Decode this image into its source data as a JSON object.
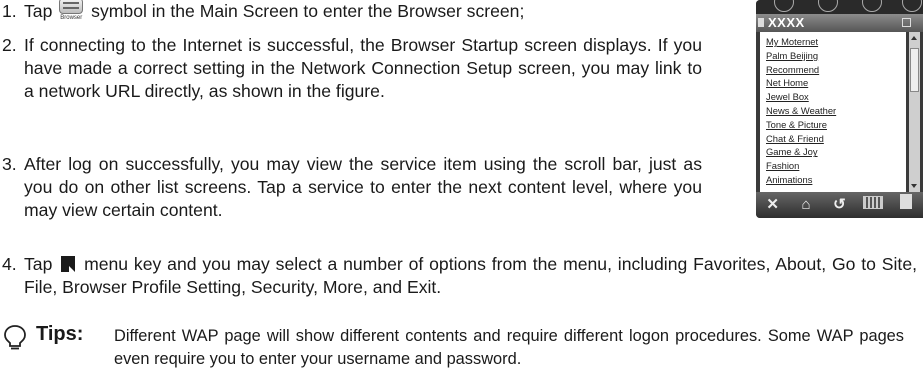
{
  "steps": {
    "s1": {
      "num": "1.",
      "before": "Tap ",
      "icon_caption": "Browser",
      "after": " symbol in the Main Screen to enter the Browser screen;"
    },
    "s2": {
      "num": "2.",
      "text": "If connecting to the Internet is successful, the Browser Startup screen displays. If you have made a correct setting in the Network Connection Setup screen, you may link to a network URL directly, as shown in the figure."
    },
    "s3": {
      "num": "3.",
      "text": "After log on successfully, you may view the service item using the scroll bar, just as you do on other list screens. Tap a service to enter the next content level, where you may view certain content."
    },
    "s4": {
      "num": "4.",
      "before": "Tap ",
      "after": " menu key and you may select a number of options from the menu, including Favorites, About, Go to Site, File, Browser Profile Setting, Security, More, and Exit."
    }
  },
  "tips": {
    "label": "Tips:",
    "text": "Different WAP page will show different contents and require different logon procedures. Some WAP pages even require you to enter your username and password."
  },
  "phone": {
    "title": "XXXX",
    "links": [
      "My Moternet",
      "Palm Beijing",
      "Recommend",
      "Net Home",
      "Jewel Box",
      "News & Weather",
      "Tone & Picture",
      "Chat & Friend",
      "Game & Joy",
      "Fashion",
      "Animations"
    ],
    "bottom_icons": [
      "close-icon",
      "home-icon",
      "refresh-icon",
      "keyboard-icon",
      "menu-icon"
    ]
  }
}
